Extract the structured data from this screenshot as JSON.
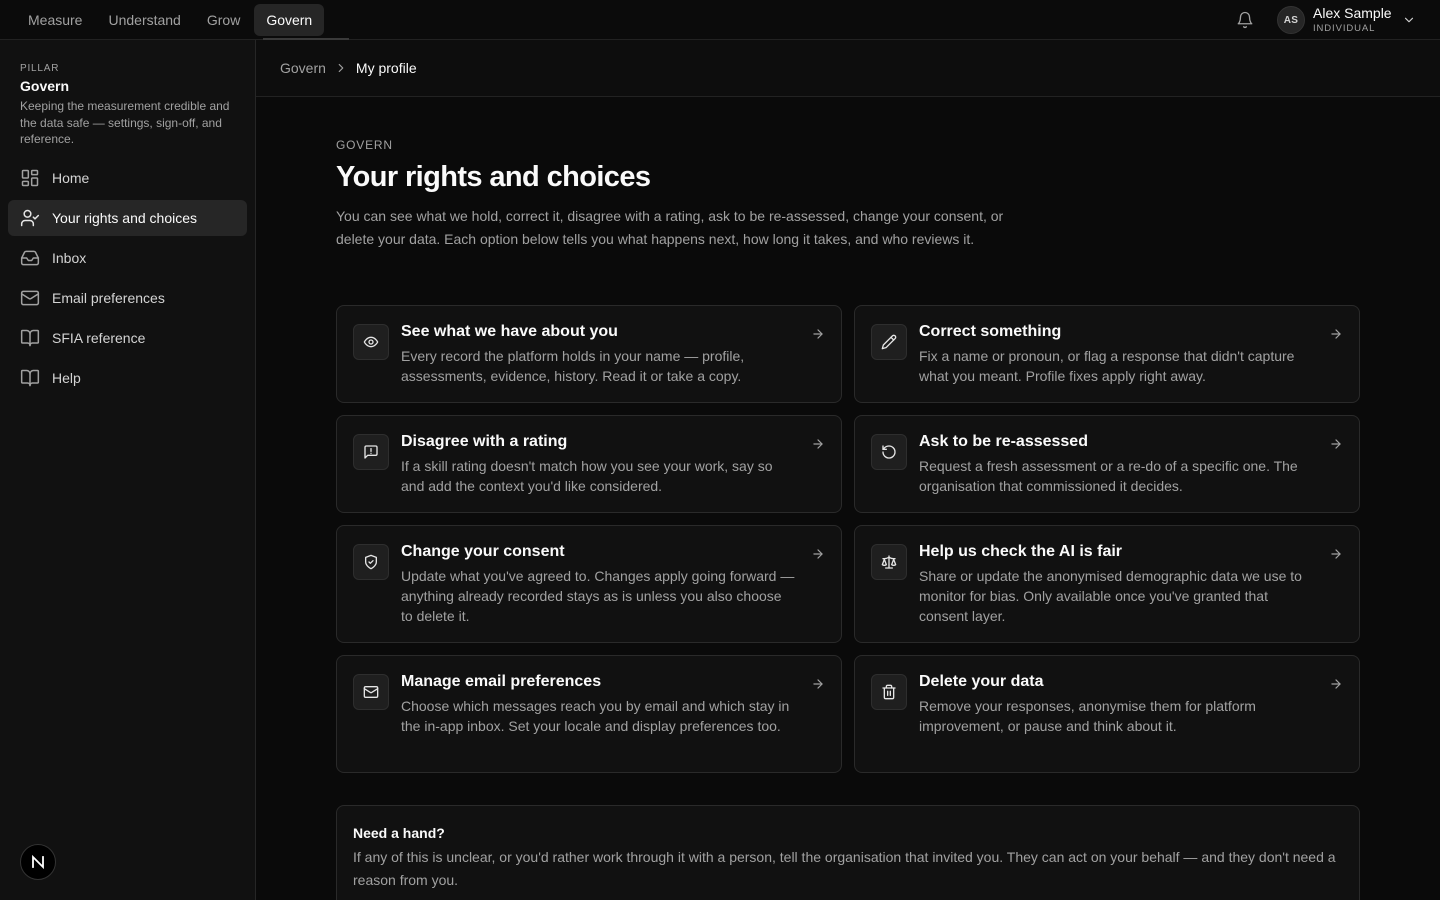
{
  "topbar": {
    "tabs": [
      {
        "label": "Measure"
      },
      {
        "label": "Understand"
      },
      {
        "label": "Grow"
      },
      {
        "label": "Govern"
      }
    ],
    "active_tab": "Govern",
    "notifications_icon": "bell-icon",
    "user": {
      "initials": "AS",
      "name": "Alex Sample",
      "role": "INDIVIDUAL"
    }
  },
  "sidebar": {
    "eyebrow": "PILLAR",
    "title": "Govern",
    "description": "Keeping the measurement credible and the data safe — settings, sign-off, and reference.",
    "items": [
      {
        "label": "Home",
        "icon": "grid-icon"
      },
      {
        "label": "Your rights and choices",
        "icon": "user-check-icon",
        "active": true
      },
      {
        "label": "Inbox",
        "icon": "inbox-icon"
      },
      {
        "label": "Email preferences",
        "icon": "mail-icon"
      },
      {
        "label": "SFIA reference",
        "icon": "book-icon"
      },
      {
        "label": "Help",
        "icon": "book-open-icon"
      }
    ],
    "brand_letter": "N"
  },
  "breadcrumb": {
    "parent": "Govern",
    "current": "My profile"
  },
  "main": {
    "eyebrow": "GOVERN",
    "title": "Your rights and choices",
    "intro": "You can see what we hold, correct it, disagree with a rating, ask to be re-assessed, change your consent, or delete your data. Each option below tells you what happens next, how long it takes, and who reviews it.",
    "cards": [
      {
        "title": "See what we have about you",
        "desc": "Every record the platform holds in your name — profile, assessments, evidence, history. Read it or take a copy.",
        "icon": "eye-icon"
      },
      {
        "title": "Correct something",
        "desc": "Fix a name or pronoun, or flag a response that didn't capture what you meant. Profile fixes apply right away.",
        "icon": "pencil-icon"
      },
      {
        "title": "Disagree with a rating",
        "desc": "If a skill rating doesn't match how you see your work, say so and add the context you'd like considered.",
        "icon": "message-alert-icon"
      },
      {
        "title": "Ask to be re-assessed",
        "desc": "Request a fresh assessment or a re-do of a specific one. The organisation that commissioned it decides.",
        "icon": "rotate-ccw-icon"
      },
      {
        "title": "Change your consent",
        "desc": "Update what you've agreed to. Changes apply going forward — anything already recorded stays as is unless you also choose to delete it.",
        "icon": "shield-check-icon"
      },
      {
        "title": "Help us check the AI is fair",
        "desc": "Share or update the anonymised demographic data we use to monitor for bias. Only available once you've granted that consent layer.",
        "icon": "scale-icon"
      },
      {
        "title": "Manage email preferences",
        "desc": "Choose which messages reach you by email and which stay in the in-app inbox. Set your locale and display preferences too.",
        "icon": "mail-icon"
      },
      {
        "title": "Delete your data",
        "desc": "Remove your responses, anonymise them for platform improvement, or pause and think about it.",
        "icon": "trash-icon"
      }
    ],
    "help": {
      "title": "Need a hand?",
      "text": "If any of this is unclear, or you'd rather work through it with a person, tell the organisation that invited you. They can act on your behalf — and they don't need a reason from you."
    }
  }
}
